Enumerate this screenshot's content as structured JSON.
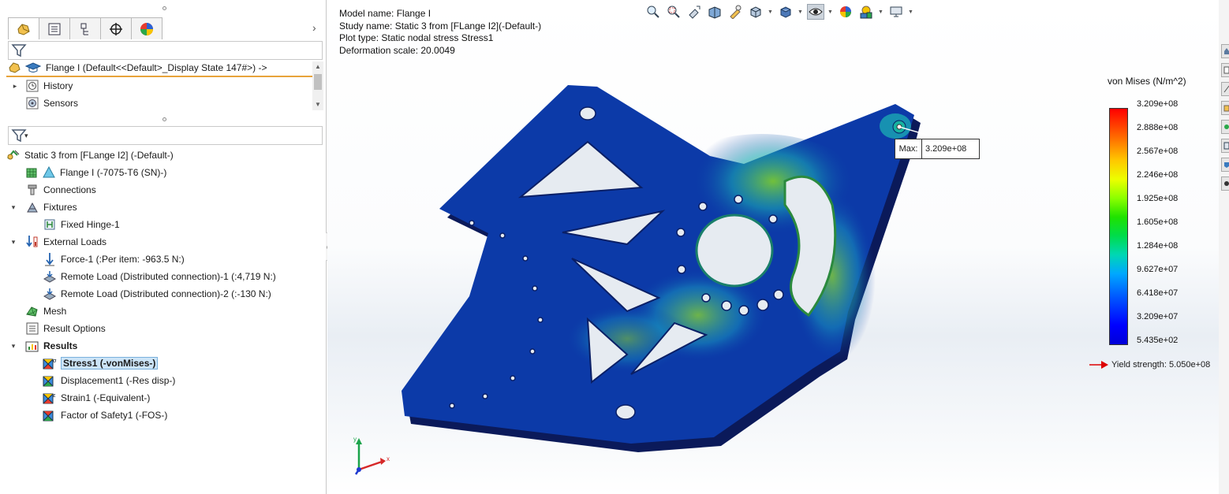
{
  "left_panel": {
    "tabs": [
      {
        "name": "feature-manager"
      },
      {
        "name": "property-manager"
      },
      {
        "name": "configuration-manager"
      },
      {
        "name": "dimxpert-manager"
      },
      {
        "name": "display-manager"
      }
    ],
    "top_tree": {
      "root": "Flange I  (Default<<Default>_Display State 147#>) ->",
      "items": [
        "History",
        "Sensors"
      ]
    },
    "filter_caret": "▾",
    "sim_tree": {
      "study": "Static 3 from [FLange I2] (-Default-)",
      "part": "Flange I (-7075-T6 (SN)-)",
      "connections": "Connections",
      "fixtures": "Fixtures",
      "fixed_hinge": "Fixed Hinge-1",
      "external_loads": "External Loads",
      "force": "Force-1 (:Per item: -963.5 N:)",
      "remote_load_1": "Remote Load (Distributed connection)-1 (:4,719 N:)",
      "remote_load_2": "Remote Load (Distributed connection)-2 (:-130 N:)",
      "mesh": "Mesh",
      "result_options": "Result Options",
      "results": "Results",
      "stress": "Stress1 (-vonMises-)",
      "displacement": "Displacement1 (-Res disp-)",
      "strain": "Strain1 (-Equivalent-)",
      "fos": "Factor of Safety1 (-FOS-)"
    }
  },
  "viewport": {
    "info": {
      "model_name": "Model name: Flange I",
      "study_name": "Study name: Static 3 from [FLange I2](-Default-)",
      "plot_type": "Plot type: Static nodal stress Stress1",
      "deformation_scale": "Deformation scale: 20.0049"
    },
    "legend": {
      "title": "von Mises (N/m^2)",
      "ticks": [
        "3.209e+08",
        "2.888e+08",
        "2.567e+08",
        "2.246e+08",
        "1.925e+08",
        "1.605e+08",
        "1.284e+08",
        "9.627e+07",
        "6.418e+07",
        "3.209e+07",
        "5.435e+02"
      ],
      "yield": "Yield strength: 5.050e+08",
      "max_color": "#ff0000",
      "min_color": "#0000ff"
    },
    "max_annotation": {
      "key": "Max:",
      "value": "3.209e+08"
    },
    "triad": {
      "x": "x",
      "y": "y"
    }
  }
}
